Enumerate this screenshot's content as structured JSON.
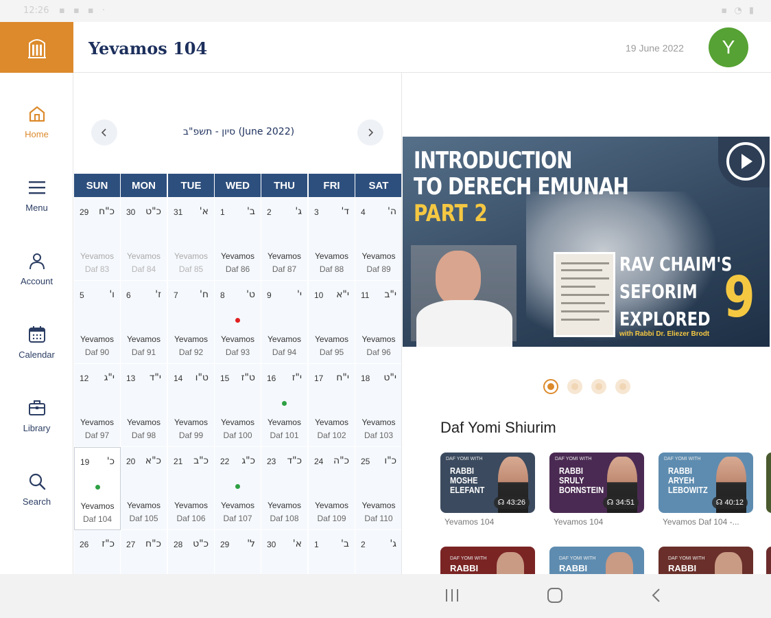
{
  "status_bar": {
    "time": "12:26"
  },
  "header": {
    "title": "Yevamos 104",
    "date": "19 June 2022",
    "avatar_letter": "Y"
  },
  "sidebar": {
    "items": [
      {
        "label": "Home",
        "icon": "home-icon"
      },
      {
        "label": "Menu",
        "icon": "menu-icon"
      },
      {
        "label": "Account",
        "icon": "account-icon"
      },
      {
        "label": "Calendar",
        "icon": "calendar-icon"
      },
      {
        "label": "Library",
        "icon": "library-icon"
      },
      {
        "label": "Search",
        "icon": "search-icon"
      }
    ]
  },
  "calendar": {
    "month_label": "סיון - תשפ\"ב (June 2022)",
    "weekdays": [
      "SUN",
      "MON",
      "TUE",
      "WED",
      "THU",
      "FRI",
      "SAT"
    ],
    "weeks": [
      [
        {
          "num": "29",
          "heb": "כ\"ח",
          "tractate": "Yevamos",
          "daf": "Daf 83",
          "past": true
        },
        {
          "num": "30",
          "heb": "כ\"ט",
          "tractate": "Yevamos",
          "daf": "Daf 84",
          "past": true
        },
        {
          "num": "31",
          "heb": "א'",
          "tractate": "Yevamos",
          "daf": "Daf 85",
          "past": true
        },
        {
          "num": "1",
          "heb": "ב'",
          "tractate": "Yevamos",
          "daf": "Daf 86"
        },
        {
          "num": "2",
          "heb": "ג'",
          "tractate": "Yevamos",
          "daf": "Daf 87"
        },
        {
          "num": "3",
          "heb": "ד'",
          "tractate": "Yevamos",
          "daf": "Daf 88"
        },
        {
          "num": "4",
          "heb": "ה'",
          "tractate": "Yevamos",
          "daf": "Daf 89"
        }
      ],
      [
        {
          "num": "5",
          "heb": "ו'",
          "tractate": "Yevamos",
          "daf": "Daf 90"
        },
        {
          "num": "6",
          "heb": "ז'",
          "tractate": "Yevamos",
          "daf": "Daf 91"
        },
        {
          "num": "7",
          "heb": "ח'",
          "tractate": "Yevamos",
          "daf": "Daf 92"
        },
        {
          "num": "8",
          "heb": "ט'",
          "tractate": "Yevamos",
          "daf": "Daf 93",
          "dot": "#e02020"
        },
        {
          "num": "9",
          "heb": "י'",
          "tractate": "Yevamos",
          "daf": "Daf 94"
        },
        {
          "num": "10",
          "heb": "י\"א",
          "tractate": "Yevamos",
          "daf": "Daf 95"
        },
        {
          "num": "11",
          "heb": "י\"ב",
          "tractate": "Yevamos",
          "daf": "Daf 96"
        }
      ],
      [
        {
          "num": "12",
          "heb": "י\"ג",
          "tractate": "Yevamos",
          "daf": "Daf 97"
        },
        {
          "num": "13",
          "heb": "י\"ד",
          "tractate": "Yevamos",
          "daf": "Daf 98"
        },
        {
          "num": "14",
          "heb": "ט\"ו",
          "tractate": "Yevamos",
          "daf": "Daf 99"
        },
        {
          "num": "15",
          "heb": "ט\"ז",
          "tractate": "Yevamos",
          "daf": "Daf 100"
        },
        {
          "num": "16",
          "heb": "י\"ז",
          "tractate": "Yevamos",
          "daf": "Daf 101",
          "dot": "#2ea043"
        },
        {
          "num": "17",
          "heb": "י\"ח",
          "tractate": "Yevamos",
          "daf": "Daf 102"
        },
        {
          "num": "18",
          "heb": "י\"ט",
          "tractate": "Yevamos",
          "daf": "Daf 103"
        }
      ],
      [
        {
          "num": "19",
          "heb": "כ'",
          "tractate": "Yevamos",
          "daf": "Daf 104",
          "dot": "#2ea043",
          "today": true
        },
        {
          "num": "20",
          "heb": "כ\"א",
          "tractate": "Yevamos",
          "daf": "Daf 105"
        },
        {
          "num": "21",
          "heb": "כ\"ב",
          "tractate": "Yevamos",
          "daf": "Daf 106"
        },
        {
          "num": "22",
          "heb": "כ\"ג",
          "tractate": "Yevamos",
          "daf": "Daf 107",
          "dot": "#2ea043"
        },
        {
          "num": "23",
          "heb": "כ\"ד",
          "tractate": "Yevamos",
          "daf": "Daf 108"
        },
        {
          "num": "24",
          "heb": "כ\"ה",
          "tractate": "Yevamos",
          "daf": "Daf 109"
        },
        {
          "num": "25",
          "heb": "כ\"ו",
          "tractate": "Yevamos",
          "daf": "Daf 110"
        }
      ],
      [
        {
          "num": "26",
          "heb": "כ\"ז",
          "tractate": "",
          "daf": ""
        },
        {
          "num": "27",
          "heb": "כ\"ח",
          "tractate": "",
          "daf": ""
        },
        {
          "num": "28",
          "heb": "כ\"ט",
          "tractate": "",
          "daf": ""
        },
        {
          "num": "29",
          "heb": "ל'",
          "tractate": "",
          "daf": ""
        },
        {
          "num": "30",
          "heb": "א'",
          "tractate": "",
          "daf": ""
        },
        {
          "num": "1",
          "heb": "ב'",
          "tractate": "",
          "daf": ""
        },
        {
          "num": "2",
          "heb": "ג'",
          "tractate": "",
          "daf": ""
        }
      ]
    ]
  },
  "banner": {
    "line1": "INTRODUCTION",
    "line2": "TO DERECH EMUNAH",
    "line3": "PART 2",
    "series_line1": "RAV CHAIM'S",
    "series_line2": "SEFORIM",
    "series_line3": "EXPLORED",
    "series_number": "9",
    "with_line": "with Rabbi Dr. Eliezer Brodt",
    "play_icon": "play-icon"
  },
  "carousel": {
    "count": 4,
    "active_index": 0
  },
  "shiurim": {
    "title": "Daf Yomi Shiurim",
    "cards": [
      {
        "top": "DAF YOMI WITH",
        "name": "RABBI\nMOSHE\nELEFANT",
        "duration": "43:26",
        "caption": "Yevamos 104",
        "bg": "#3b4a5e"
      },
      {
        "top": "DAF YOMI WITH",
        "name": "RABBI\nSRULY\nBORNSTEIN",
        "duration": "34:51",
        "caption": "Yevamos 104",
        "bg": "#4a2a52"
      },
      {
        "top": "DAF YOMI WITH",
        "name": "RABBI\nARYEH\nLEBOWITZ",
        "duration": "40:12",
        "caption": "Yevamos Daf 104 -...",
        "bg": "#5e8cb0"
      }
    ],
    "cards_row2": [
      {
        "top": "DAF YOMI WITH",
        "name": "RABBI",
        "bg": "#7a2424"
      },
      {
        "top": "DAF YOMI WITH",
        "name": "RABBI",
        "bg": "#5e8cb0"
      },
      {
        "top": "DAF YOMI WITH",
        "name": "RABBI",
        "bg": "#6a2f2a"
      }
    ]
  },
  "android_nav": [
    "recent-apps-icon",
    "home-circle-icon",
    "back-icon"
  ]
}
